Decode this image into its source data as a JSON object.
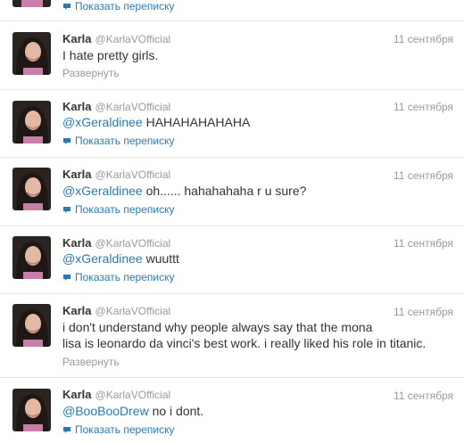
{
  "top": {
    "convo_label": "Показать переписку"
  },
  "tweets": [
    {
      "name": "Karla",
      "handle": "@KarlaVOfficial",
      "time": "11 сентября",
      "mention": "",
      "text": "I hate pretty girls.",
      "text2": "",
      "action": "Развернуть"
    },
    {
      "name": "Karla",
      "handle": "@KarlaVOfficial",
      "time": "11 сентября",
      "mention": "@xGeraldinee",
      "text": " HAHAHAHAHAHA",
      "text2": "",
      "action": "Показать переписку"
    },
    {
      "name": "Karla",
      "handle": "@KarlaVOfficial",
      "time": "11 сентября",
      "mention": "@xGeraldinee",
      "text": " oh...... hahahahaha r u sure?",
      "text2": "",
      "action": "Показать переписку"
    },
    {
      "name": "Karla",
      "handle": "@KarlaVOfficial",
      "time": "11 сентября",
      "mention": "@xGeraldinee",
      "text": " wuuttt",
      "text2": "",
      "action": "Показать переписку"
    },
    {
      "name": "Karla",
      "handle": "@KarlaVOfficial",
      "time": "11 сентября",
      "mention": "",
      "text": "i don't understand why people always say that the mona",
      "text2": "lisa is leonardo da vinci's best work. i really liked his role in titanic.",
      "action": "Развернуть"
    },
    {
      "name": "Karla",
      "handle": "@KarlaVOfficial",
      "time": "11 сентября",
      "mention": "@BooBooDrew",
      "text": " no i dont.",
      "text2": "",
      "action": "Показать переписку"
    }
  ],
  "icons": {
    "avatar": "avatar-photo",
    "convo": "speech-bubble-icon"
  },
  "colors": {
    "link": "#2a7ab0",
    "muted": "#999999",
    "text": "#333333"
  }
}
